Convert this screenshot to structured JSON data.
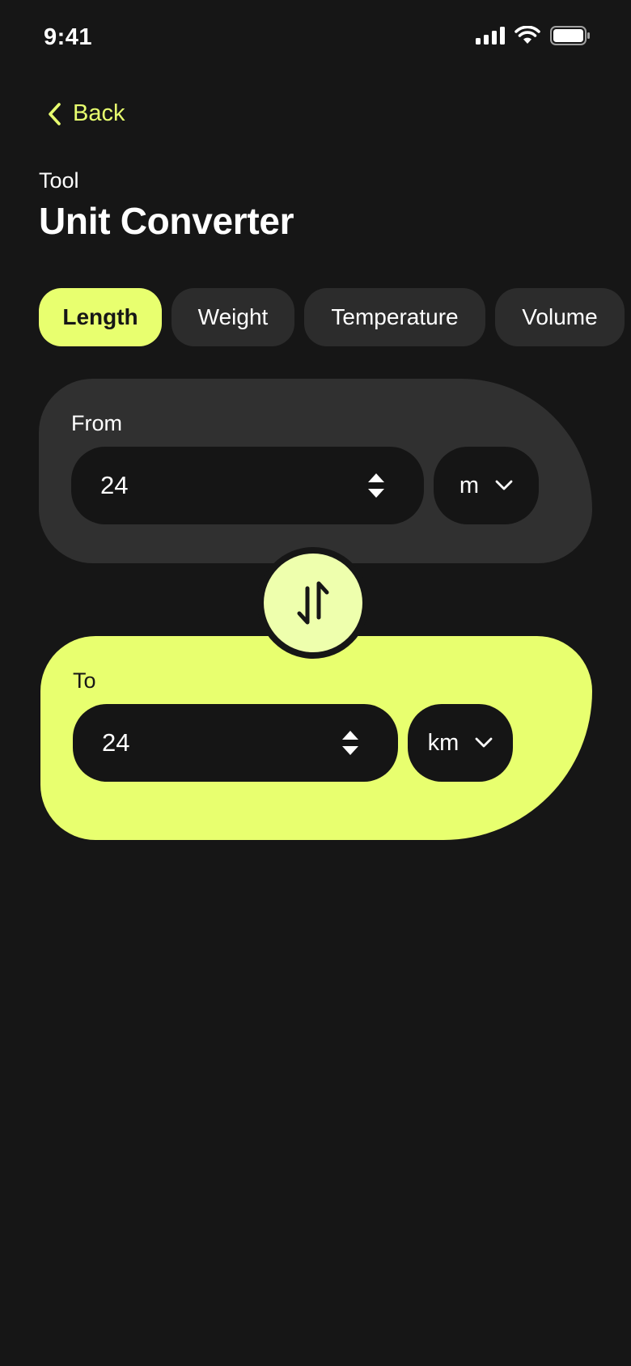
{
  "status_bar": {
    "time": "9:41",
    "icons": [
      "cellular-signal-icon",
      "wifi-icon",
      "battery-icon"
    ]
  },
  "nav": {
    "back_label": "Back",
    "back_icon": "chevron-left-icon"
  },
  "header": {
    "subtitle": "Tool",
    "title": "Unit Converter"
  },
  "tabs": [
    {
      "label": "Length",
      "active": true
    },
    {
      "label": "Weight",
      "active": false
    },
    {
      "label": "Temperature",
      "active": false
    },
    {
      "label": "Volume",
      "active": false
    }
  ],
  "from": {
    "label": "From",
    "value": "24",
    "unit": "m"
  },
  "to": {
    "label": "To",
    "value": "24",
    "unit": "km"
  },
  "swap": {
    "icon": "swap-vertical-icon"
  },
  "colors": {
    "background": "#161616",
    "accent": "#e8ff6f",
    "card_dark": "#303030",
    "field": "#151515",
    "tab_inactive": "#2c2c2c",
    "swap_fill": "#eeffad"
  }
}
